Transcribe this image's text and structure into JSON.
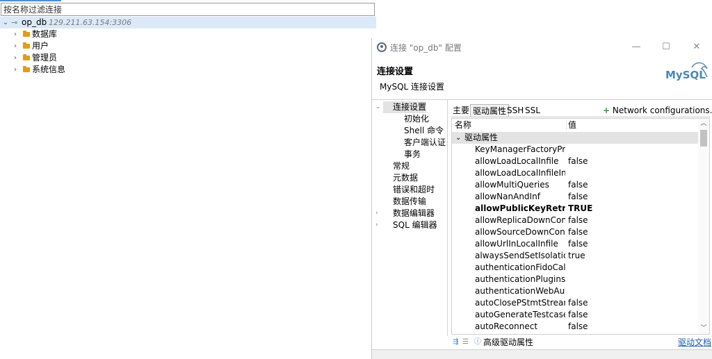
{
  "navigator": {
    "filter_placeholder": "按名称过滤连接",
    "connection": {
      "name": "op_db",
      "host": "129.211.63.154:3306"
    },
    "children": [
      "数据库",
      "用户",
      "管理员",
      "系统信息"
    ]
  },
  "dialog": {
    "title": "连接 \"op_db\" 配置",
    "minimize": "—",
    "maximize": "☐",
    "close": "✕",
    "header_title": "连接设置",
    "header_subtitle": "MySQL 连接设置",
    "logo_text": "MySQL",
    "nav": {
      "connection_settings": "连接设置",
      "init": "初始化",
      "shell": "Shell 命令",
      "client_auth": "客户端认证",
      "transactions": "事务",
      "general": "常规",
      "metadata": "元数据",
      "errors_timeouts": "错误和超时",
      "data_transfer": "数据传输",
      "data_editor": "数据编辑器",
      "sql_editor": "SQL 编辑器"
    },
    "tabs": {
      "main": "主要",
      "driver_props": "驱动属性",
      "ssh": "SSH",
      "ssl": "SSL"
    },
    "network_configs": "Network configurations...",
    "grid": {
      "col_name": "名称",
      "col_value": "值",
      "group": "驱动属性",
      "rows": [
        {
          "name": "KeyManagerFactoryProvider",
          "value": ""
        },
        {
          "name": "allowLoadLocalInfile",
          "value": "false"
        },
        {
          "name": "allowLoadLocalInfileInPath",
          "value": ""
        },
        {
          "name": "allowMultiQueries",
          "value": "false"
        },
        {
          "name": "allowNanAndInf",
          "value": "false"
        },
        {
          "name": "allowPublicKeyRetrieval",
          "value": "TRUE"
        },
        {
          "name": "allowReplicaDownConnections",
          "value": "false"
        },
        {
          "name": "allowSourceDownConnections",
          "value": "false"
        },
        {
          "name": "allowUrlInLocalInfile",
          "value": "false"
        },
        {
          "name": "alwaysSendSetIsolation",
          "value": "true"
        },
        {
          "name": "authenticationFidoCallbackHandler",
          "value": ""
        },
        {
          "name": "authenticationPlugins",
          "value": ""
        },
        {
          "name": "authenticationWebAuthnCallbackHandler",
          "value": ""
        },
        {
          "name": "autoClosePStmtStreams",
          "value": "false"
        },
        {
          "name": "autoGenerateTestcaseScript",
          "value": "false"
        },
        {
          "name": "autoReconnect",
          "value": "false"
        }
      ]
    },
    "footer": {
      "advanced": "高级驱动属性",
      "driver_docs": "驱动文档"
    }
  }
}
